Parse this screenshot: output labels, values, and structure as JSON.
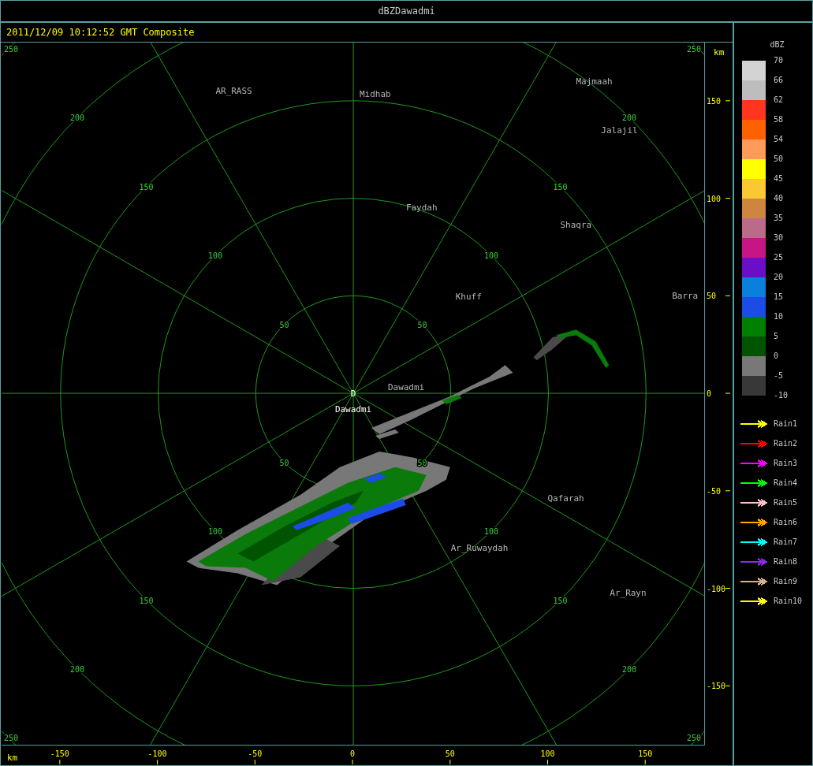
{
  "window": {
    "title": "dBZDawadmi"
  },
  "header": {
    "timestamp": "2011/12/09 10:12:52 GMT Composite"
  },
  "plot": {
    "x_unit": "km",
    "y_unit": "km",
    "x_ticks": [
      "-150",
      "-100",
      "-50",
      "0",
      "50",
      "100",
      "150"
    ],
    "y_ticks": [
      "150",
      "100",
      "50",
      "0",
      "-50",
      "-100",
      "-150"
    ],
    "rings": [
      {
        "labels": [
          "50",
          "50",
          "50",
          "50"
        ]
      },
      {
        "labels": [
          "100",
          "100",
          "100",
          "100"
        ]
      },
      {
        "labels": [
          "150",
          "150",
          "150",
          "150"
        ]
      },
      {
        "labels": [
          "200",
          "200",
          "200",
          "200"
        ]
      },
      {
        "labels": [
          "250",
          "250",
          "250",
          "250"
        ]
      }
    ],
    "site": {
      "symbol": "D",
      "name": "Dawadmi"
    },
    "cities": [
      {
        "name": "AR_RASS"
      },
      {
        "name": "Midhab"
      },
      {
        "name": "Majmaah"
      },
      {
        "name": "Jalajil"
      },
      {
        "name": "Faydah"
      },
      {
        "name": "Shaqra"
      },
      {
        "name": "Khuff"
      },
      {
        "name": "Barra"
      },
      {
        "name": "Dawadmi"
      },
      {
        "name": "Qafarah"
      },
      {
        "name": "Ar_Ruwaydah"
      },
      {
        "name": "Ar_Rayn"
      }
    ]
  },
  "legend": {
    "title": "dBZ",
    "labels": [
      "70",
      "66",
      "62",
      "58",
      "54",
      "50",
      "45",
      "40",
      "35",
      "30",
      "25",
      "20",
      "15",
      "10",
      "5",
      "0",
      "-5",
      "-10"
    ],
    "bands": [
      {
        "color": "#d3d3d3"
      },
      {
        "color": "#bdbdbd"
      },
      {
        "color": "#ff3520"
      },
      {
        "color": "#ff6000"
      },
      {
        "color": "#ff9a5a"
      },
      {
        "color": "#ffff00"
      },
      {
        "color": "#fac832"
      },
      {
        "color": "#cd853f"
      },
      {
        "color": "#bc6a8a"
      },
      {
        "color": "#c71585"
      },
      {
        "color": "#6a0fc7"
      },
      {
        "color": "#0a80dc"
      },
      {
        "color": "#1c4ce6"
      },
      {
        "color": "#008000"
      },
      {
        "color": "#005400"
      },
      {
        "color": "#787878"
      },
      {
        "color": "#383838"
      }
    ],
    "tracks": [
      {
        "label": "Rain1",
        "color": "#ffff00"
      },
      {
        "label": "Rain2",
        "color": "#ff0000"
      },
      {
        "label": "Rain3",
        "color": "#ff00ff"
      },
      {
        "label": "Rain4",
        "color": "#00ff00"
      },
      {
        "label": "Rain5",
        "color": "#ffc0cb"
      },
      {
        "label": "Rain6",
        "color": "#ffa500"
      },
      {
        "label": "Rain7",
        "color": "#00ffff"
      },
      {
        "label": "Rain8",
        "color": "#8a2be2"
      },
      {
        "label": "Rain9",
        "color": "#d2b48c"
      },
      {
        "label": "Rain10",
        "color": "#ffff00"
      }
    ]
  }
}
